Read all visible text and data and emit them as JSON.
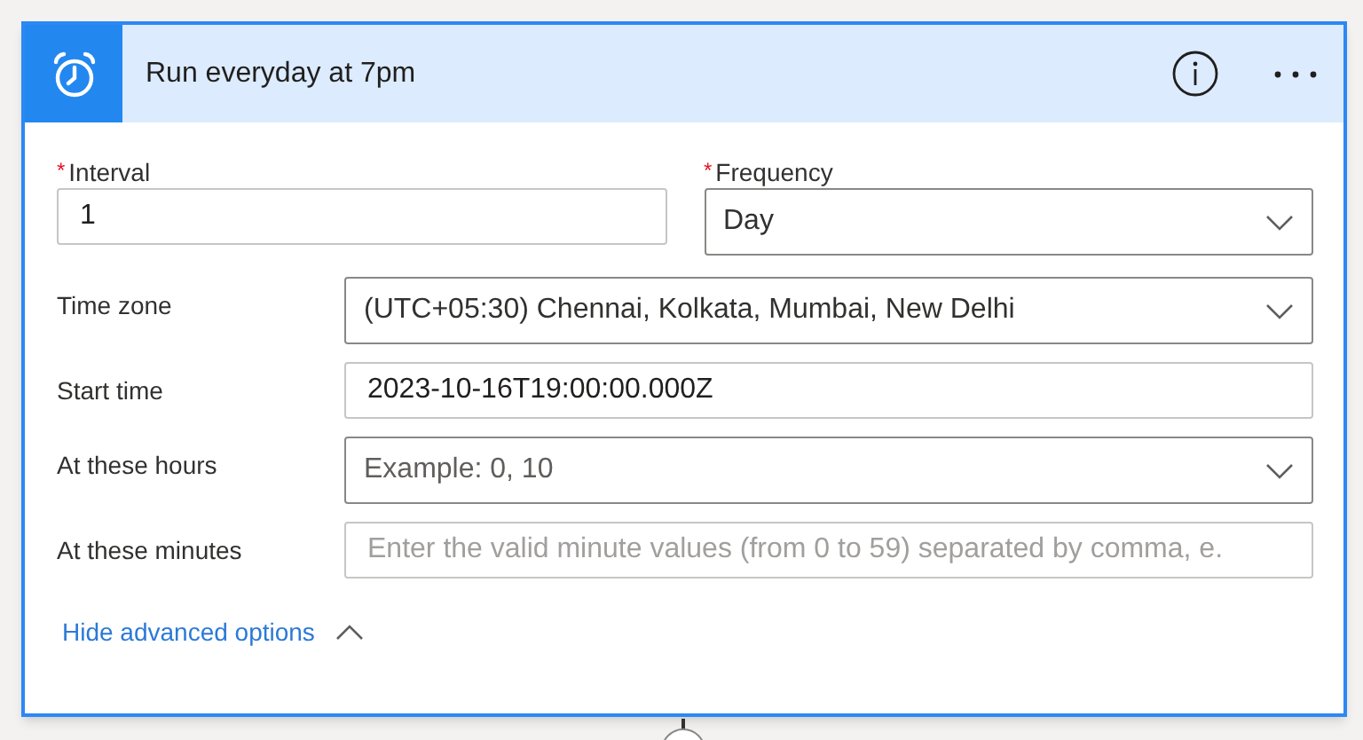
{
  "card": {
    "title": "Run everyday at 7pm"
  },
  "required_fields": [
    {
      "label": "Interval",
      "required_mark": "*",
      "kind": "text",
      "value": "1"
    },
    {
      "label": "Frequency",
      "required_mark": "*",
      "kind": "dropdown",
      "value": "Day"
    }
  ],
  "fields": [
    {
      "label": "Time zone",
      "kind": "dropdown",
      "value": "(UTC+05:30) Chennai, Kolkata, Mumbai, New Delhi"
    },
    {
      "label": "Start time",
      "kind": "text",
      "value": "2023-10-16T19:00:00.000Z"
    },
    {
      "label": "At these hours",
      "kind": "dropdown",
      "placeholder": "Example: 0, 10"
    },
    {
      "label": "At these minutes",
      "kind": "text",
      "placeholder": "Enter the valid minute values (from 0 to 59) separated by comma, e."
    }
  ],
  "advanced_link": {
    "label": "Hide advanced options",
    "expanded": true
  }
}
